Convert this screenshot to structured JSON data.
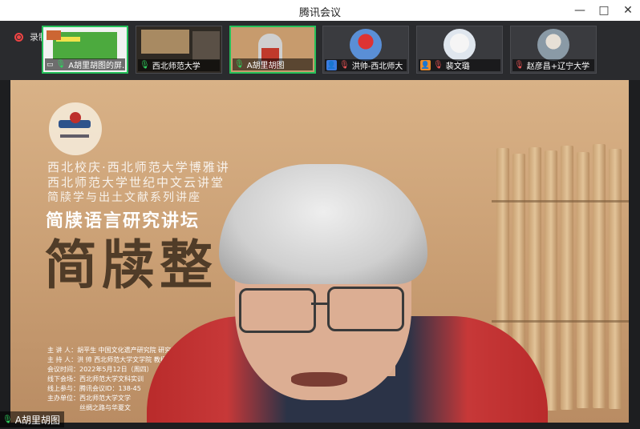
{
  "window": {
    "title": "腾讯会议",
    "minimize": "—",
    "maximize": "□",
    "close": "✕"
  },
  "record": {
    "label": "录制中"
  },
  "participants": [
    {
      "name": "A胡里胡图的屏…",
      "mic": "on",
      "icon": "screen",
      "active": true
    },
    {
      "name": "西北师范大学",
      "mic": "on",
      "icon": "none",
      "active": false
    },
    {
      "name": "A胡里胡图",
      "mic": "on",
      "icon": "none",
      "active": true
    },
    {
      "name": "洪帅-西北师大",
      "mic": "off",
      "icon": "person",
      "active": false
    },
    {
      "name": "裴文璐",
      "mic": "off",
      "icon": "person-orange",
      "active": false
    },
    {
      "name": "赵彦昌+辽宁大学",
      "mic": "off",
      "icon": "none",
      "active": false
    }
  ],
  "poster": {
    "line1": "西北校庆·西北师范大学博雅讲",
    "line2": "西北师范大学世纪中文云讲堂",
    "line3": "简牍学与出土文献系列讲座",
    "subtitle": "简牍语言研究讲坛",
    "big": "简牍整",
    "info": [
      "主 讲 人：胡平生  中国文化遗产研究院 研究员",
      "主 持 人：洪 帅  西北师范大学文学院 教授",
      "会议时间：2022年5月12日（周四）",
      "线下会场：西北师范大学文科实训",
      "线上参与：腾讯会议ID：138-45",
      "主办单位：西北师范大学文学",
      "　　　　　丝绸之路与华夏文"
    ]
  },
  "speaker": {
    "name": "A胡里胡图"
  }
}
